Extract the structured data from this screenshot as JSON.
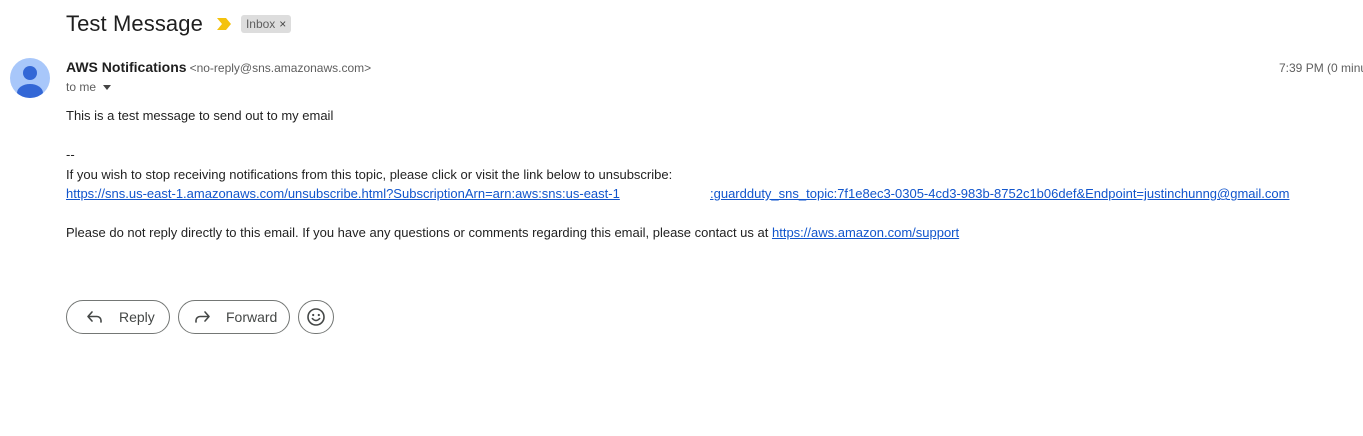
{
  "message": {
    "subject": "Test Message",
    "label_chip": "Inbox",
    "label_chip_close": "×",
    "sender_name": "AWS Notifications",
    "sender_email": "<no-reply@sns.amazonaws.com>",
    "timestamp": "7:39 PM (0 minu",
    "recipient": "to me",
    "colors": {
      "importance_marker": "#f4c20d",
      "avatar_bg": "#a8c7fa",
      "avatar_figure": "#3367d6",
      "link": "#1155cc"
    }
  },
  "body": {
    "line1": "This is a test message to send out to my email",
    "separator": "--",
    "unsubscribe_intro": "If you wish to stop receiving notifications from this topic, please click or visit the link below to unsubscribe:",
    "unsubscribe_link_part1": "https://sns.us-east-1.amazonaws.com/unsubscribe.html?SubscriptionArn=arn:aws:sns:us-east-1",
    "unsubscribe_link_part2": ":guardduty_sns_topic:7f1e8ec3-0305-4cd3-983b-8752c1b06def&Endpoint=justinchunng@gmail.com",
    "no_reply_text": "Please do not reply directly to this email. If you have any questions or comments regarding this email, please contact us at ",
    "support_link": "https://aws.amazon.com/support"
  },
  "actions": {
    "reply_label": "Reply",
    "forward_label": "Forward",
    "reply_icon": "reply-arrow-icon",
    "forward_icon": "forward-arrow-icon",
    "emoji_icon": "smiley-emoji-icon"
  }
}
